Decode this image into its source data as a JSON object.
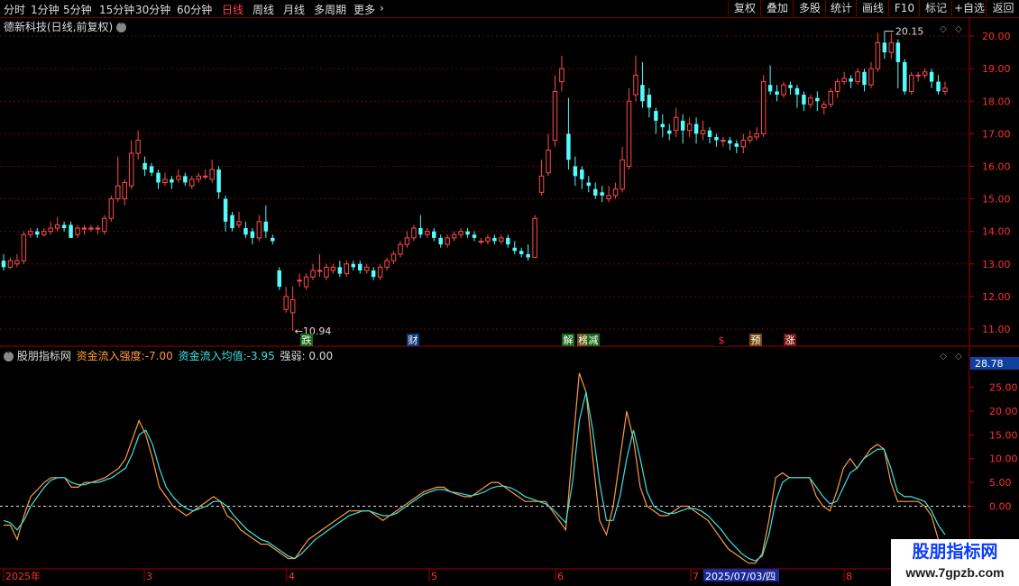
{
  "toolbar": {
    "periods": [
      "分时",
      "1分钟",
      "5分钟",
      "15分钟",
      "30分钟",
      "60分钟",
      "日线",
      "周线",
      "月线",
      "多周期",
      "更多"
    ],
    "active_period": "日线",
    "right_buttons": [
      "复权",
      "叠加",
      "多股",
      "统计",
      "画线",
      "F10",
      "标记",
      "+自选",
      "返回"
    ]
  },
  "stock_title": "德新科技(日线,前复权)",
  "price_axis": [
    "20.00",
    "19.00",
    "18.00",
    "17.00",
    "16.00",
    "15.00",
    "14.00",
    "13.00",
    "12.00",
    "11.00"
  ],
  "high_marker": "20.15",
  "low_marker": "10.94",
  "event_tags": [
    "跌",
    "财",
    "解",
    "榜",
    "减",
    "$",
    "预",
    "涨"
  ],
  "indicator": {
    "name": "股朋指标网",
    "strength_label": "资金流入强度:",
    "strength_value": "-7.00",
    "avg_label": "资金流入均值:",
    "avg_value": "-3.95",
    "weak_label": "强弱:",
    "weak_value": "0.00",
    "axis_current": "28.78",
    "axis": [
      "25.00",
      "20.00",
      "15.00",
      "10.00",
      "5.00",
      "0.00"
    ]
  },
  "time_axis": [
    "2025年",
    "3",
    "4",
    "5",
    "6",
    "7",
    "8"
  ],
  "crosshair_date": "2025/07/03/四",
  "watermark": {
    "title": "股朋指标网",
    "url": "www.7gpzb.com"
  },
  "colors": {
    "up": "#ff4a4a",
    "down": "#54fcfc",
    "grid": "#7a0000",
    "orange": "#ff9a3c",
    "cyan": "#40e0e0"
  },
  "chart_data": [
    {
      "type": "candlestick",
      "ylim": [
        10.5,
        20.5
      ],
      "candles": [
        [
          13.1,
          12.9,
          13.3,
          12.8
        ],
        [
          12.9,
          13.1,
          13.2,
          12.85
        ],
        [
          13.0,
          13.1,
          13.3,
          12.9
        ],
        [
          13.1,
          13.9,
          14.0,
          13.0
        ],
        [
          13.9,
          14.0,
          14.1,
          13.8
        ],
        [
          14.0,
          13.9,
          14.1,
          13.8
        ],
        [
          13.9,
          14.0,
          14.1,
          13.85
        ],
        [
          14.0,
          14.1,
          14.3,
          13.9
        ],
        [
          14.1,
          14.2,
          14.45,
          14.0
        ],
        [
          14.2,
          14.1,
          14.3,
          14.0
        ],
        [
          14.2,
          13.8,
          14.3,
          13.8
        ],
        [
          13.9,
          14.1,
          14.2,
          13.8
        ],
        [
          14.1,
          14.1,
          14.2,
          13.9
        ],
        [
          14.1,
          14.1,
          14.2,
          14.0
        ],
        [
          14.1,
          14.1,
          14.2,
          13.9
        ],
        [
          14.0,
          14.4,
          14.5,
          13.9
        ],
        [
          14.4,
          15.0,
          15.1,
          14.3
        ],
        [
          15.0,
          15.4,
          16.3,
          14.9
        ],
        [
          15.0,
          15.5,
          15.6,
          14.8
        ],
        [
          15.4,
          16.4,
          16.8,
          15.3
        ],
        [
          16.4,
          16.8,
          17.1,
          16.2
        ],
        [
          16.1,
          15.9,
          16.3,
          15.7
        ],
        [
          16.0,
          15.8,
          16.1,
          15.7
        ],
        [
          15.8,
          15.5,
          15.9,
          15.3
        ],
        [
          15.5,
          15.6,
          15.8,
          15.4
        ],
        [
          15.6,
          15.5,
          15.7,
          15.3
        ],
        [
          15.6,
          15.7,
          15.9,
          15.5
        ],
        [
          15.7,
          15.5,
          15.8,
          15.4
        ],
        [
          15.4,
          15.6,
          15.7,
          15.3
        ],
        [
          15.6,
          15.7,
          15.8,
          15.5
        ],
        [
          15.7,
          15.7,
          15.9,
          15.6
        ],
        [
          15.6,
          15.9,
          16.2,
          15.5
        ],
        [
          15.9,
          15.2,
          16.0,
          15.0
        ],
        [
          15.0,
          14.3,
          15.1,
          14.0
        ],
        [
          14.5,
          14.1,
          14.6,
          14.0
        ],
        [
          14.2,
          14.3,
          14.6,
          14.1
        ],
        [
          14.1,
          13.9,
          14.3,
          13.8
        ],
        [
          14.0,
          13.8,
          14.1,
          13.6
        ],
        [
          13.8,
          14.3,
          14.5,
          13.7
        ],
        [
          14.3,
          14.0,
          14.8,
          13.8
        ],
        [
          13.8,
          13.7,
          13.9,
          13.6
        ],
        [
          12.8,
          12.3,
          12.9,
          12.2
        ],
        [
          11.6,
          12.0,
          12.3,
          11.5
        ],
        [
          11.5,
          11.9,
          12.3,
          10.94
        ],
        [
          12.5,
          12.5,
          12.7,
          12.3
        ],
        [
          12.3,
          12.6,
          12.7,
          12.2
        ],
        [
          12.6,
          12.8,
          13.0,
          12.5
        ],
        [
          12.8,
          12.8,
          13.3,
          12.6
        ],
        [
          12.6,
          12.9,
          13.0,
          12.5
        ],
        [
          12.8,
          12.9,
          13.0,
          12.7
        ],
        [
          12.9,
          12.7,
          13.1,
          12.6
        ],
        [
          12.7,
          13.0,
          13.1,
          12.6
        ],
        [
          13.0,
          12.9,
          13.1,
          12.8
        ],
        [
          13.0,
          12.8,
          13.1,
          12.7
        ],
        [
          12.8,
          12.9,
          13.0,
          12.7
        ],
        [
          12.8,
          12.6,
          12.9,
          12.5
        ],
        [
          12.6,
          12.9,
          13.0,
          12.5
        ],
        [
          12.9,
          13.1,
          13.2,
          12.8
        ],
        [
          13.1,
          13.3,
          13.4,
          13.0
        ],
        [
          13.3,
          13.6,
          13.7,
          13.2
        ],
        [
          13.6,
          13.8,
          14.0,
          13.5
        ],
        [
          13.8,
          14.1,
          14.2,
          13.7
        ],
        [
          14.1,
          13.9,
          14.5,
          13.8
        ],
        [
          13.9,
          14.0,
          14.1,
          13.8
        ],
        [
          14.0,
          13.8,
          14.1,
          13.7
        ],
        [
          13.8,
          13.6,
          13.9,
          13.5
        ],
        [
          13.6,
          13.8,
          13.9,
          13.5
        ],
        [
          13.8,
          13.9,
          14.0,
          13.7
        ],
        [
          13.9,
          14.0,
          14.1,
          13.8
        ],
        [
          14.0,
          13.9,
          14.1,
          13.8
        ],
        [
          13.9,
          13.8,
          14.0,
          13.7
        ],
        [
          13.7,
          13.7,
          13.8,
          13.6
        ],
        [
          13.7,
          13.8,
          13.9,
          13.6
        ],
        [
          13.8,
          13.7,
          13.9,
          13.6
        ],
        [
          13.7,
          13.8,
          13.9,
          13.6
        ],
        [
          13.8,
          13.6,
          13.9,
          13.5
        ],
        [
          13.5,
          13.4,
          13.7,
          13.3
        ],
        [
          13.4,
          13.3,
          13.5,
          13.2
        ],
        [
          13.3,
          13.2,
          13.6,
          13.1
        ],
        [
          13.2,
          14.4,
          14.5,
          13.2
        ],
        [
          15.2,
          15.7,
          16.2,
          15.1
        ],
        [
          15.8,
          16.5,
          17.0,
          15.7
        ],
        [
          16.8,
          18.3,
          18.8,
          16.6
        ],
        [
          18.6,
          19.0,
          19.4,
          18.3
        ],
        [
          17.0,
          16.2,
          18.1,
          15.9
        ],
        [
          16.0,
          15.7,
          16.3,
          15.4
        ],
        [
          15.9,
          15.6,
          16.0,
          15.3
        ],
        [
          15.5,
          15.4,
          15.7,
          15.2
        ],
        [
          15.3,
          15.1,
          15.5,
          15.0
        ],
        [
          15.2,
          15.1,
          15.4,
          14.9
        ],
        [
          15.0,
          15.1,
          15.4,
          14.9
        ],
        [
          15.1,
          15.3,
          15.5,
          15.0
        ],
        [
          15.3,
          16.2,
          16.6,
          15.2
        ],
        [
          16.0,
          18.0,
          18.4,
          15.9
        ],
        [
          18.2,
          18.8,
          19.4,
          18.0
        ],
        [
          18.5,
          18.0,
          19.2,
          17.8
        ],
        [
          18.2,
          17.8,
          18.4,
          17.5
        ],
        [
          17.7,
          17.4,
          17.8,
          17.0
        ],
        [
          17.3,
          17.2,
          17.6,
          16.9
        ],
        [
          17.1,
          17.0,
          17.3,
          16.8
        ],
        [
          17.1,
          17.5,
          17.8,
          16.9
        ],
        [
          17.4,
          17.1,
          17.6,
          16.7
        ],
        [
          17.1,
          17.3,
          17.5,
          16.9
        ],
        [
          17.3,
          17.0,
          17.5,
          16.7
        ],
        [
          17.0,
          17.1,
          17.4,
          16.8
        ],
        [
          17.1,
          16.9,
          17.2,
          16.7
        ],
        [
          16.9,
          16.8,
          17.0,
          16.6
        ],
        [
          16.8,
          16.8,
          16.9,
          16.6
        ],
        [
          16.8,
          16.7,
          16.9,
          16.5
        ],
        [
          16.7,
          16.6,
          16.8,
          16.4
        ],
        [
          16.6,
          16.8,
          17.0,
          16.4
        ],
        [
          16.8,
          16.9,
          17.1,
          16.7
        ],
        [
          16.9,
          17.0,
          17.2,
          16.8
        ],
        [
          17.0,
          18.6,
          18.8,
          16.9
        ],
        [
          18.5,
          18.3,
          19.1,
          18.2
        ],
        [
          18.3,
          18.2,
          18.5,
          18.0
        ],
        [
          18.2,
          18.5,
          18.6,
          18.1
        ],
        [
          18.5,
          18.4,
          18.6,
          18.2
        ],
        [
          18.4,
          18.2,
          18.5,
          17.8
        ],
        [
          18.2,
          17.9,
          18.3,
          17.7
        ],
        [
          17.9,
          18.1,
          18.2,
          17.8
        ],
        [
          18.1,
          18.0,
          18.3,
          17.7
        ],
        [
          17.8,
          17.9,
          18.0,
          17.6
        ],
        [
          17.9,
          18.3,
          18.4,
          17.8
        ],
        [
          18.3,
          18.6,
          18.7,
          18.1
        ],
        [
          18.6,
          18.7,
          18.9,
          18.5
        ],
        [
          18.7,
          18.6,
          18.8,
          18.4
        ],
        [
          18.6,
          18.9,
          19.0,
          18.5
        ],
        [
          18.9,
          18.5,
          19.0,
          18.3
        ],
        [
          18.5,
          19.0,
          19.2,
          18.4
        ],
        [
          19.0,
          19.8,
          20.1,
          18.9
        ],
        [
          19.8,
          19.5,
          20.15,
          19.3
        ],
        [
          19.5,
          19.8,
          20.1,
          19.3
        ],
        [
          19.8,
          19.2,
          19.9,
          18.4
        ],
        [
          19.2,
          18.3,
          19.3,
          18.2
        ],
        [
          18.3,
          18.8,
          18.9,
          18.2
        ],
        [
          18.8,
          18.8,
          18.9,
          18.6
        ],
        [
          18.8,
          18.9,
          19.0,
          18.7
        ],
        [
          18.9,
          18.6,
          19.0,
          18.4
        ],
        [
          18.6,
          18.3,
          18.8,
          18.2
        ],
        [
          18.3,
          18.4,
          18.6,
          18.2
        ]
      ]
    },
    {
      "type": "line",
      "ylim": [
        -13,
        31
      ],
      "series": [
        {
          "name": "资金流入强度",
          "values": [
            -4,
            -4,
            -7,
            -2,
            2,
            3.5,
            5,
            6,
            6,
            6,
            4,
            4,
            5,
            5,
            5.5,
            6,
            7,
            8,
            10,
            14,
            18,
            15,
            10,
            4,
            2,
            0,
            -1,
            -2,
            -1,
            0,
            1,
            2,
            1,
            -2,
            -3,
            -5,
            -6,
            -7,
            -8,
            -8,
            -9,
            -10,
            -11,
            -11,
            -9,
            -7,
            -6,
            -5,
            -4,
            -3,
            -2,
            -1,
            -1,
            -1,
            -1,
            -2,
            -3,
            -2,
            -1,
            0,
            1,
            2,
            3,
            3.5,
            4,
            4,
            3,
            2.5,
            2,
            2,
            3,
            4,
            5,
            5,
            4,
            3,
            2,
            1,
            1,
            1,
            1,
            -1,
            -3,
            -5,
            12,
            28,
            24,
            10,
            -3,
            -6,
            0,
            10,
            20,
            14,
            4,
            0,
            -1,
            -2,
            -2,
            -1,
            0,
            0,
            -1,
            -2,
            -3,
            -5,
            -7,
            -9,
            -10,
            -11,
            -12,
            -12,
            -10,
            -3,
            6,
            7,
            6,
            6,
            6,
            6,
            2,
            0,
            -1,
            3,
            8,
            10,
            8,
            10,
            12,
            13,
            12,
            5,
            1,
            1,
            1,
            1,
            0,
            -2,
            -7,
            -10
          ]
        },
        {
          "name": "资金流入均值",
          "values": [
            -3,
            -3.5,
            -5,
            -3,
            0,
            2,
            4,
            5.5,
            6,
            6,
            5,
            4.5,
            4.5,
            5,
            5,
            5.5,
            6,
            7,
            8,
            11,
            15,
            16,
            13,
            8,
            4,
            2,
            0.5,
            -0.5,
            -1,
            -0.5,
            0,
            1,
            1,
            0,
            -2,
            -3.5,
            -5,
            -6,
            -7,
            -7.5,
            -8.5,
            -9.5,
            -10.5,
            -11,
            -10,
            -8.5,
            -7,
            -6,
            -5,
            -4,
            -3,
            -2,
            -1.5,
            -1,
            -1,
            -1.5,
            -2,
            -2,
            -1.5,
            -0.5,
            0.5,
            1.5,
            2.5,
            3,
            3.5,
            3.5,
            3,
            2.8,
            2.5,
            2.2,
            2.5,
            3,
            3.8,
            4.2,
            4.2,
            3.8,
            3,
            2,
            1.5,
            1,
            0.5,
            -0.5,
            -2,
            -3.5,
            5,
            18,
            24,
            16,
            5,
            -3,
            -3,
            2,
            10,
            16,
            10,
            3,
            0,
            -1,
            -1.5,
            -1.5,
            -1,
            -0.5,
            -0.5,
            -1,
            -2,
            -3.5,
            -5,
            -7,
            -8.5,
            -10,
            -11,
            -11.5,
            -10.5,
            -6,
            1,
            5,
            6,
            6,
            6,
            6,
            4,
            2,
            0.5,
            1,
            4,
            7,
            8,
            10,
            11,
            12,
            12,
            8,
            3,
            2,
            2,
            1.5,
            1,
            -1,
            -4,
            -6
          ]
        }
      ]
    }
  ]
}
